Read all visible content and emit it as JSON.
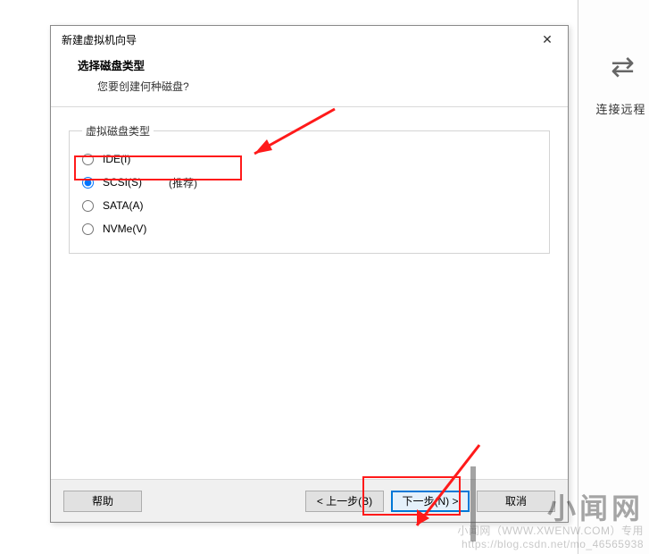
{
  "backdrop": {
    "icon_glyph": "⇄",
    "label": "连接远程"
  },
  "dialog": {
    "title": "新建虚拟机向导",
    "close_glyph": "✕",
    "header": {
      "title": "选择磁盘类型",
      "subtitle": "您要创建何种磁盘?"
    },
    "group_legend": "虚拟磁盘类型",
    "options": [
      {
        "label": "IDE(I)",
        "recommend": "",
        "checked": false
      },
      {
        "label": "SCSI(S)",
        "recommend": "(推荐)",
        "checked": true
      },
      {
        "label": "SATA(A)",
        "recommend": "",
        "checked": false
      },
      {
        "label": "NVMe(V)",
        "recommend": "",
        "checked": false
      }
    ],
    "buttons": {
      "help": "帮助",
      "back": "< 上一步(B)",
      "next": "下一步(N) >",
      "cancel": "取消"
    }
  },
  "annotation": {
    "color": "#ff1a1a"
  },
  "watermark": {
    "brand": "小闻网",
    "line1": "小闻网（WWW.XWENW.COM）专用",
    "line2": "https://blog.csdn.net/mo_46565938"
  }
}
